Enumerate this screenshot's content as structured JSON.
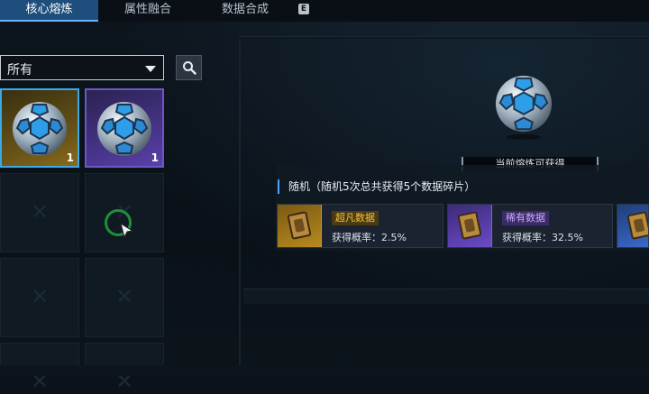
{
  "tabs": [
    {
      "label": "核心熔炼",
      "active": true
    },
    {
      "label": "属性融合",
      "active": false
    },
    {
      "label": "数据合成",
      "active": false
    }
  ],
  "hotkey": "E",
  "filter": {
    "selected": "所有",
    "icon": "chevron-down-icon"
  },
  "search_icon": "search-icon",
  "inventory": {
    "slots": [
      {
        "item": "core-orb",
        "rarity": "gold",
        "count": "1"
      },
      {
        "item": "core-orb",
        "rarity": "purple",
        "count": "1"
      }
    ]
  },
  "preview": {
    "label": "当前熔炼可获得"
  },
  "rewards": {
    "title": "随机（随机5次总共获得5个数据碎片）",
    "items": [
      {
        "name": "超凡数据",
        "rate": "获得概率：2.5%",
        "color": "#f0c040"
      },
      {
        "name": "稀有数据",
        "rate": "获得概率：32.5%",
        "color": "#c9a8ff"
      }
    ]
  }
}
